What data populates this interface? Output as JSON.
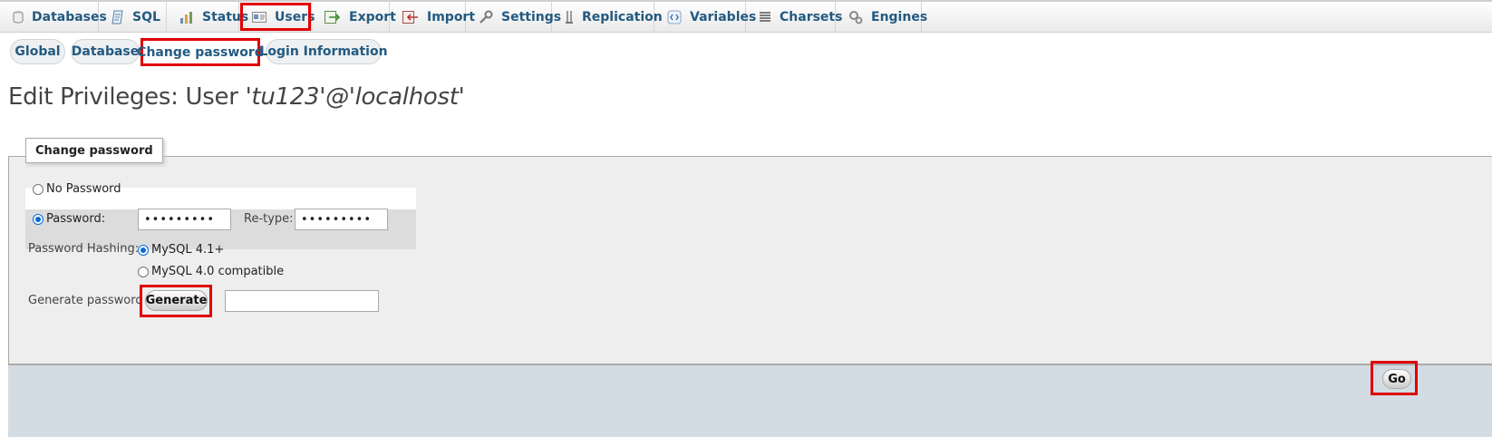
{
  "topnav": {
    "tabs": [
      {
        "label": "Databases",
        "icon": "database-icon"
      },
      {
        "label": "SQL",
        "icon": "sql-icon"
      },
      {
        "label": "Status",
        "icon": "status-icon"
      },
      {
        "label": "Users",
        "icon": "users-icon",
        "highlighted": true
      },
      {
        "label": "Export",
        "icon": "export-icon"
      },
      {
        "label": "Import",
        "icon": "import-icon"
      },
      {
        "label": "Settings",
        "icon": "settings-icon"
      },
      {
        "label": "Replication",
        "icon": "replication-icon"
      },
      {
        "label": "Variables",
        "icon": "variables-icon"
      },
      {
        "label": "Charsets",
        "icon": "charsets-icon"
      },
      {
        "label": "Engines",
        "icon": "engines-icon"
      }
    ]
  },
  "subtabs": [
    {
      "label": "Global"
    },
    {
      "label": "Database"
    },
    {
      "label": "Change password",
      "active": true
    },
    {
      "label": "Login Information"
    }
  ],
  "page": {
    "title_prefix": "Edit Privileges: User ",
    "title_user": "'tu123'@'localhost'"
  },
  "form": {
    "legend": "Change password",
    "no_password_label": "No Password",
    "password_label": "Password:",
    "password_value": "•••••••••",
    "retype_label": "Re-type:",
    "retype_value": "•••••••••",
    "hashing_label": "Password Hashing:",
    "hashing_options": [
      "MySQL 4.1+",
      "MySQL 4.0 compatible"
    ],
    "hashing_selected": "MySQL 4.1+",
    "generate_label": "Generate password",
    "generate_button": "Generate",
    "generated_value": "",
    "go_button": "Go"
  },
  "colors": {
    "accent": "#235a81",
    "highlight": "#e00000",
    "fieldset_bg": "#eeeeee",
    "footer_bg": "#d3dce3"
  }
}
